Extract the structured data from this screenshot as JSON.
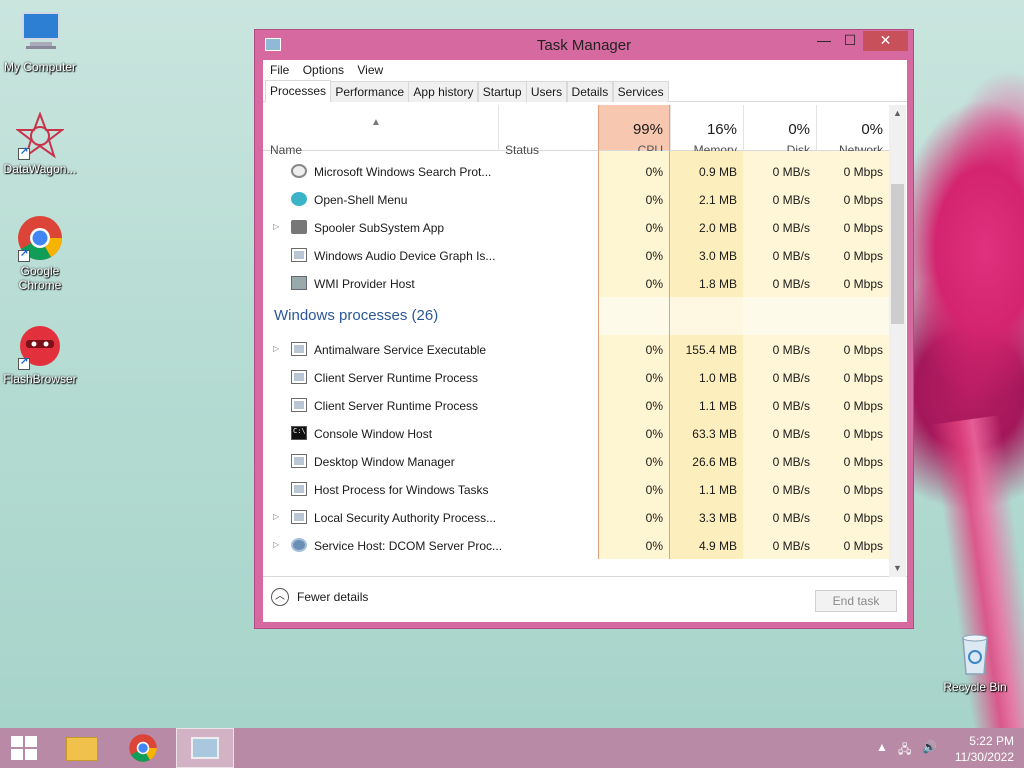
{
  "desktop": {
    "icons": [
      {
        "label": "My Computer",
        "icon": "computer-icon"
      },
      {
        "label": "DataWagon...",
        "icon": "datawagon-icon"
      },
      {
        "label": "Google Chrome",
        "icon": "chrome-icon"
      },
      {
        "label": "FlashBrowser",
        "icon": "flashbrowser-icon"
      },
      {
        "label": "Recycle Bin",
        "icon": "recycle-bin-icon"
      }
    ]
  },
  "window": {
    "title": "Task Manager",
    "min_glyph": "—",
    "max_glyph": "☐",
    "close_glyph": "✕"
  },
  "menu": [
    "File",
    "Options",
    "View"
  ],
  "tabs": [
    "Processes",
    "Performance",
    "App history",
    "Startup",
    "Users",
    "Details",
    "Services"
  ],
  "columns": {
    "name": "Name",
    "status": "Status",
    "cpu": {
      "pct": "99%",
      "label": "CPU"
    },
    "memory": {
      "pct": "16%",
      "label": "Memory"
    },
    "disk": {
      "pct": "0%",
      "label": "Disk"
    },
    "network": {
      "pct": "0%",
      "label": "Network"
    }
  },
  "rows": [
    {
      "name": "Microsoft Windows Search Prot...",
      "icon": "search-icon",
      "cpu": "0%",
      "memory": "0.9 MB",
      "disk": "0 MB/s",
      "network": "0 Mbps",
      "expandable": false
    },
    {
      "name": "Open-Shell Menu",
      "icon": "shell-icon",
      "cpu": "0%",
      "memory": "2.1 MB",
      "disk": "0 MB/s",
      "network": "0 Mbps",
      "expandable": false
    },
    {
      "name": "Spooler SubSystem App",
      "icon": "printer-icon",
      "cpu": "0%",
      "memory": "2.0 MB",
      "disk": "0 MB/s",
      "network": "0 Mbps",
      "expandable": true
    },
    {
      "name": "Windows Audio Device Graph Is...",
      "icon": "process-icon",
      "cpu": "0%",
      "memory": "3.0 MB",
      "disk": "0 MB/s",
      "network": "0 Mbps",
      "expandable": false
    },
    {
      "name": "WMI Provider Host",
      "icon": "wmi-icon",
      "cpu": "0%",
      "memory": "1.8 MB",
      "disk": "0 MB/s",
      "network": "0 Mbps",
      "expandable": false
    }
  ],
  "group": {
    "title": "Windows processes (26)"
  },
  "group_rows": [
    {
      "name": "Antimalware Service Executable",
      "icon": "process-icon",
      "cpu": "0%",
      "memory": "155.4 MB",
      "disk": "0 MB/s",
      "network": "0 Mbps",
      "expandable": true
    },
    {
      "name": "Client Server Runtime Process",
      "icon": "process-icon",
      "cpu": "0%",
      "memory": "1.0 MB",
      "disk": "0 MB/s",
      "network": "0 Mbps",
      "expandable": false
    },
    {
      "name": "Client Server Runtime Process",
      "icon": "process-icon",
      "cpu": "0%",
      "memory": "1.1 MB",
      "disk": "0 MB/s",
      "network": "0 Mbps",
      "expandable": false
    },
    {
      "name": "Console Window Host",
      "icon": "console-icon",
      "cpu": "0%",
      "memory": "63.3 MB",
      "disk": "0 MB/s",
      "network": "0 Mbps",
      "expandable": false
    },
    {
      "name": "Desktop Window Manager",
      "icon": "process-icon",
      "cpu": "0%",
      "memory": "26.6 MB",
      "disk": "0 MB/s",
      "network": "0 Mbps",
      "expandable": false
    },
    {
      "name": "Host Process for Windows Tasks",
      "icon": "process-icon",
      "cpu": "0%",
      "memory": "1.1 MB",
      "disk": "0 MB/s",
      "network": "0 Mbps",
      "expandable": false
    },
    {
      "name": "Local Security Authority Process...",
      "icon": "process-icon",
      "cpu": "0%",
      "memory": "3.3 MB",
      "disk": "0 MB/s",
      "network": "0 Mbps",
      "expandable": true
    },
    {
      "name": "Service Host: DCOM Server Proc...",
      "icon": "gear-icon",
      "cpu": "0%",
      "memory": "4.9 MB",
      "disk": "0 MB/s",
      "network": "0 Mbps",
      "expandable": true
    }
  ],
  "footer": {
    "fewer_details": "Fewer details",
    "end_task": "End task"
  },
  "taskbar": {
    "time": "5:22 PM",
    "date": "11/30/2022"
  },
  "colors": {
    "window_frame": "#d66aa0",
    "close_button": "#c7505a",
    "cpu_highlight": "#f7c7b0",
    "memory_heat": "#fdefbd",
    "group_title": "#2b5797",
    "taskbar": "#b88aa6"
  }
}
